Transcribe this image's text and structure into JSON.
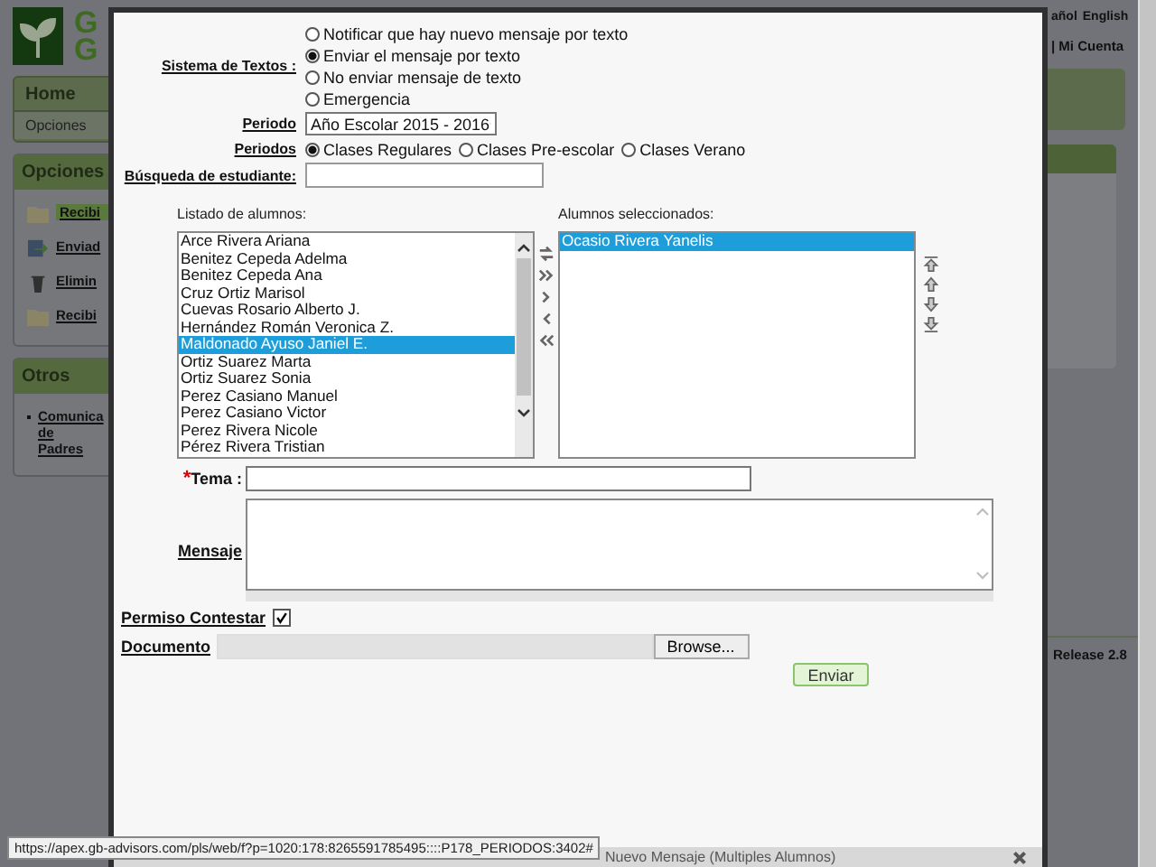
{
  "header": {
    "logo_text": [
      "G",
      "G"
    ],
    "language_links": [
      "añol",
      "English"
    ],
    "account_link": "| Mi Cuenta"
  },
  "nav": {
    "tab": "Home",
    "subtab": "Opciones"
  },
  "sidebar": [
    {
      "title": "Opciones",
      "items": [
        {
          "label": "Recibi",
          "kind": "folder",
          "selected": true
        },
        {
          "label": "Enviad",
          "kind": "send",
          "selected": false
        },
        {
          "label": "Elimin",
          "kind": "trash",
          "selected": false
        },
        {
          "label": "Recibi",
          "kind": "folder",
          "selected": false
        }
      ]
    },
    {
      "title": "Otros",
      "items": [
        {
          "label": "Comunica de Padres",
          "kind": "bullet",
          "selected": false
        }
      ]
    }
  ],
  "release": "Release 2.8",
  "dialog": {
    "sms_system": {
      "label": "Sistema de Textos :",
      "options": [
        {
          "label": "Notificar que hay nuevo mensaje por texto",
          "selected": false
        },
        {
          "label": "Enviar el mensaje por texto",
          "selected": true
        },
        {
          "label": "No enviar mensaje de texto",
          "selected": false
        },
        {
          "label": "Emergencia",
          "selected": false
        }
      ]
    },
    "period": {
      "label": "Periodo",
      "value": "Año Escolar 2015 - 2016"
    },
    "periods": {
      "label": "Periodos",
      "options": [
        {
          "label": "Clases Regulares",
          "selected": true
        },
        {
          "label": "Clases Pre-escolar",
          "selected": false
        },
        {
          "label": "Clases Verano",
          "selected": false
        }
      ]
    },
    "search": {
      "label": "Búsqueda de estudiante:"
    },
    "available": {
      "label": "Listado de alumnos:",
      "items": [
        {
          "label": "Arce Rivera Ariana",
          "selected": false
        },
        {
          "label": "Benitez Cepeda Adelma",
          "selected": false
        },
        {
          "label": "Benitez Cepeda Ana",
          "selected": false
        },
        {
          "label": "Cruz Ortiz Marisol",
          "selected": false
        },
        {
          "label": "Cuevas Rosario Alberto J.",
          "selected": false
        },
        {
          "label": "Hernández Román Veronica Z.",
          "selected": false
        },
        {
          "label": "Maldonado Ayuso Janiel E.",
          "selected": true
        },
        {
          "label": "Ortiz Suarez Marta",
          "selected": false
        },
        {
          "label": "Ortiz Suarez Sonia",
          "selected": false
        },
        {
          "label": "Perez Casiano Manuel",
          "selected": false
        },
        {
          "label": "Perez Casiano Victor",
          "selected": false
        },
        {
          "label": "Perez Rivera Nicole",
          "selected": false
        },
        {
          "label": "Pérez Rivera Tristian",
          "selected": false
        }
      ]
    },
    "chosen": {
      "label": "Alumnos seleccionados:",
      "items": [
        {
          "label": "Ocasio Rivera Yanelis",
          "selected": true
        }
      ]
    },
    "subject": {
      "label": "Tema :",
      "required_mark": "*"
    },
    "message": {
      "label": "Mensaje"
    },
    "allow_reply": {
      "label": "Permiso Contestar",
      "checked": true
    },
    "document": {
      "label": "Documento",
      "button": "Browse..."
    },
    "submit": "Enviar",
    "title": "Nuevo Mensaje (Multiples Alumnos)"
  },
  "status_url": "https://apex.gb-advisors.com/pls/web/f?p=1020:178:8265591785495::::P178_PERIODOS:3402#"
}
